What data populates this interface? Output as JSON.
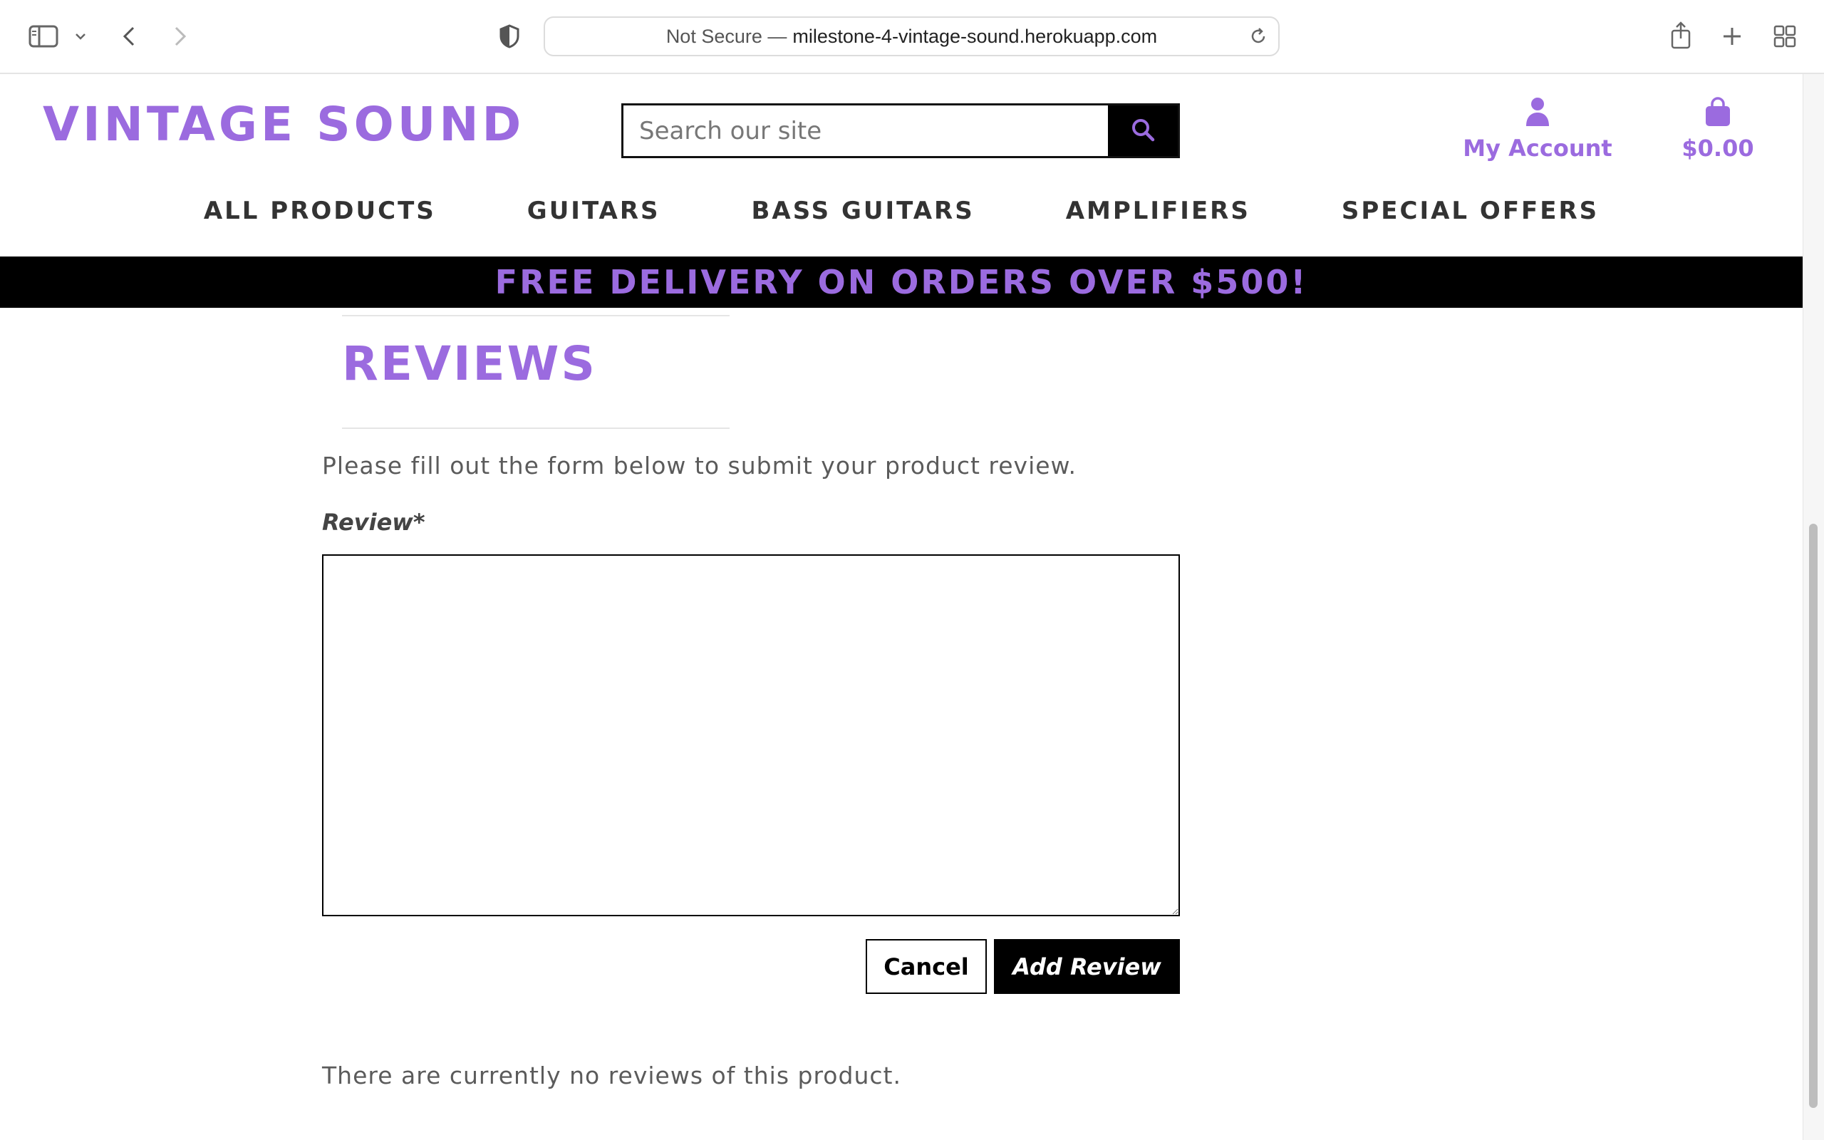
{
  "browser": {
    "url_prefix": "Not Secure —",
    "url_host": "milestone-4-vintage-sound.herokuapp.com"
  },
  "site": {
    "logo": "VINTAGE SOUND",
    "search_placeholder": "Search our site",
    "account_label": "My Account",
    "cart_total": "$0.00",
    "accent_color": "#9b6bdf"
  },
  "nav": {
    "items": [
      "ALL PRODUCTS",
      "GUITARS",
      "BASS GUITARS",
      "AMPLIFIERS",
      "SPECIAL OFFERS"
    ]
  },
  "banner": {
    "text": "FREE DELIVERY ON ORDERS OVER $500!"
  },
  "reviews": {
    "title": "REVIEWS",
    "intro": "Please fill out the form below to submit your product review.",
    "field_label": "Review*",
    "review_value": "",
    "cancel_label": "Cancel",
    "submit_label": "Add Review",
    "empty_message": "There are currently no reviews of this product."
  }
}
